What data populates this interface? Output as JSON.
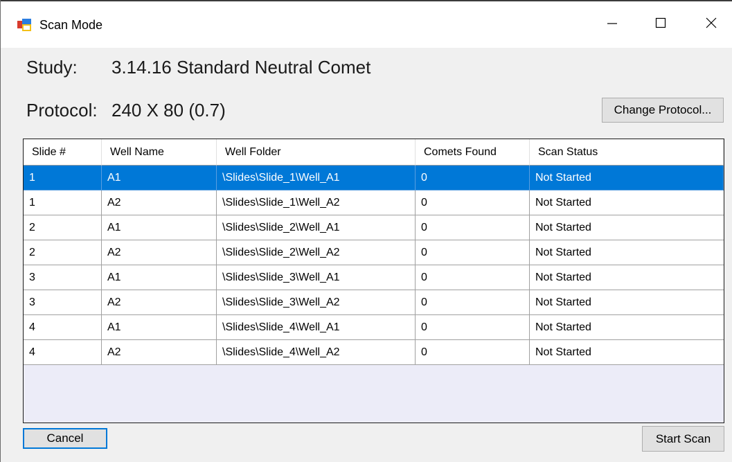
{
  "window": {
    "title": "Scan Mode"
  },
  "study": {
    "label": "Study:",
    "value": "3.14.16 Standard Neutral Comet"
  },
  "protocol": {
    "label": "Protocol:",
    "value": "240 X 80 (0.7)",
    "change_button": "Change Protocol..."
  },
  "table": {
    "columns": [
      "Slide #",
      "Well Name",
      "Well Folder",
      "Comets Found",
      "Scan Status"
    ],
    "rows": [
      [
        "1",
        "A1",
        "\\Slides\\Slide_1\\Well_A1",
        "0",
        "Not Started"
      ],
      [
        "1",
        "A2",
        "\\Slides\\Slide_1\\Well_A2",
        "0",
        "Not Started"
      ],
      [
        "2",
        "A1",
        "\\Slides\\Slide_2\\Well_A1",
        "0",
        "Not Started"
      ],
      [
        "2",
        "A2",
        "\\Slides\\Slide_2\\Well_A2",
        "0",
        "Not Started"
      ],
      [
        "3",
        "A1",
        "\\Slides\\Slide_3\\Well_A1",
        "0",
        "Not Started"
      ],
      [
        "3",
        "A2",
        "\\Slides\\Slide_3\\Well_A2",
        "0",
        "Not Started"
      ],
      [
        "4",
        "A1",
        "\\Slides\\Slide_4\\Well_A1",
        "0",
        "Not Started"
      ],
      [
        "4",
        "A2",
        "\\Slides\\Slide_4\\Well_A2",
        "0",
        "Not Started"
      ]
    ],
    "selected_row": 0
  },
  "footer": {
    "cancel_button": "Cancel",
    "start_button": "Start Scan"
  },
  "colors": {
    "selection": "#0078d7",
    "grid_empty": "#ececf8"
  },
  "icons": {
    "app": "app-window-icon",
    "minimize": "minimize-icon",
    "maximize": "maximize-icon",
    "close": "close-icon"
  }
}
